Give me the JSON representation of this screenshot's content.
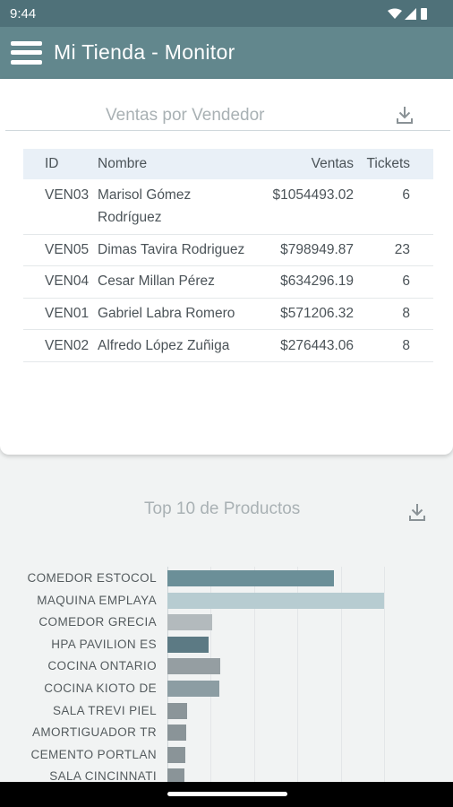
{
  "status": {
    "time": "9:44",
    "icons": [
      "wifi-icon",
      "signal-icon",
      "battery-icon"
    ]
  },
  "appbar": {
    "title": "Mi Tienda - Monitor",
    "menu_icon": "hamburger-menu-icon"
  },
  "sales_card": {
    "title": "Ventas por Vendedor",
    "download_icon": "download-icon",
    "columns": [
      "ID",
      "Nombre",
      "Ventas",
      "Tickets"
    ],
    "rows": [
      {
        "id": "VEN03",
        "name": [
          "Marisol Gómez",
          "Rodríguez"
        ],
        "sales": "$1054493.02",
        "tickets": "6"
      },
      {
        "id": "VEN05",
        "name": [
          "Dimas Tavira Rodriguez"
        ],
        "sales": "$798949.87",
        "tickets": "23"
      },
      {
        "id": "VEN04",
        "name": [
          "Cesar Millan Pérez"
        ],
        "sales": "$634296.19",
        "tickets": "6"
      },
      {
        "id": "VEN01",
        "name": [
          "Gabriel Labra Romero"
        ],
        "sales": "$571206.32",
        "tickets": "8"
      },
      {
        "id": "VEN02",
        "name": [
          "Alfredo López Zuñiga"
        ],
        "sales": "$276443.06",
        "tickets": "8"
      }
    ]
  },
  "products_card": {
    "title": "Top 10 de Productos",
    "download_icon": "download-icon"
  },
  "colors": {
    "statusbar": "#4f7179",
    "appbar": "#62878d",
    "header_bg": "#e9f0f7"
  },
  "chart_data": {
    "type": "bar",
    "orientation": "horizontal",
    "categories": [
      "COMEDOR ESTOCOL",
      "MAQUINA EMPLAYA",
      "COMEDOR GRECIA",
      "HPA PAVILION ES",
      "COCINA ONTARIO",
      "COCINA KIOTO DE",
      "SALA TREVI PIEL",
      "AMORTIGUADOR TR",
      "CEMENTO PORTLAN",
      "SALA CINCINNATI"
    ],
    "values": [
      192,
      250,
      52,
      48,
      61,
      60,
      23,
      22,
      21,
      20
    ],
    "colors": [
      "#6b8f98",
      "#b7ccd1",
      "#b3babd",
      "#5c7a84",
      "#959ea2",
      "#8c9da3",
      "#8b9599",
      "#8a9498",
      "#8a9498",
      "#8a9498"
    ],
    "grid": true,
    "xlim": [
      0,
      250
    ]
  }
}
